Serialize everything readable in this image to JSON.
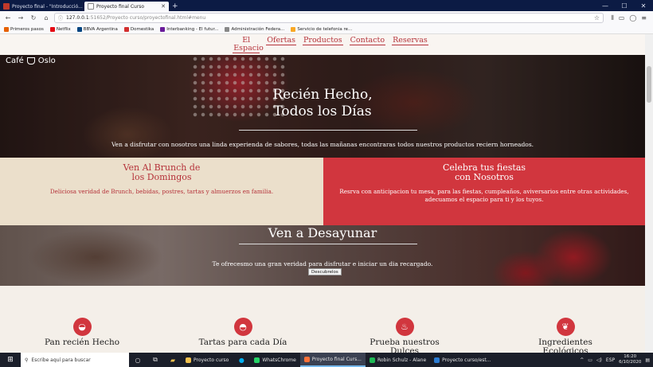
{
  "browser": {
    "tabs": [
      {
        "label": "Proyecto final - \"Introducció...",
        "active": false
      },
      {
        "label": "Proyecto final Curso",
        "active": true
      }
    ],
    "new_tab": "+",
    "window_controls": {
      "minimize": "—",
      "maximize": "☐",
      "close": "✕"
    },
    "url_prefix": "127.0.0.1",
    "url_rest": ":51652/Proyecto curso/proyectofinal.html#menu",
    "bookmarks": [
      {
        "label": "Primeros pasos",
        "color": "#e66000"
      },
      {
        "label": "Netflix",
        "color": "#e50914"
      },
      {
        "label": "BBVA Argentina",
        "color": "#004481"
      },
      {
        "label": "Domestika",
        "color": "#d32f2f"
      },
      {
        "label": "Interbanking - El futur...",
        "color": "#6a1b9a"
      },
      {
        "label": "Administración Federa...",
        "color": "#888888"
      },
      {
        "label": "Servicio de telefonia re...",
        "color": "#f9a825"
      }
    ]
  },
  "site": {
    "nav": [
      "El Espacio",
      "Ofertas",
      "Productos",
      "Contacto",
      "Reservas"
    ],
    "logo_left": "Café",
    "logo_right": "Oslo",
    "hero_title_1": "Recién Hecho,",
    "hero_title_2": "Todos los Días",
    "hero_text": "Ven a disfrutar con nosotros una linda experienda de sabores, todas las mañanas encontraras todos nuestros productos reciern horneados.",
    "brunch_title_1": "Ven Al Brunch de",
    "brunch_title_2": "los Domingos",
    "brunch_text": "Deliciosa veridad de Brunch, bebidas, postres, tartas y almuerzos en familia.",
    "party_title_1": "Celebra tus fiestas",
    "party_title_2": "con Nosotros",
    "party_text": "Resrva con anticipacion tu mesa, para las fiestas, cumpleaños, aviversarios entre otras actividades, adecuamos el espacio para ti y los tuyos.",
    "breakfast_title": "Ven a Desayunar",
    "breakfast_text": "Te ofrecesmo una gran veridad para disfrutar e iniciar un dia recargado.",
    "breakfast_button": "Descubrelos",
    "features": [
      {
        "label_1": "Pan recién Hecho",
        "label_2": "",
        "icon": "bread-icon"
      },
      {
        "label_1": "Tartas para cada Día",
        "label_2": "",
        "icon": "pie-icon"
      },
      {
        "label_1": "Prueba nuestros",
        "label_2": "Dulces",
        "icon": "cupcake-icon"
      },
      {
        "label_1": "Ingredientes",
        "label_2": "Ecológicos",
        "icon": "leaf-icon"
      }
    ],
    "accent_color": "#d1363e"
  },
  "taskbar": {
    "search_placeholder": "Escribe aquí para buscar",
    "apps": [
      {
        "label": "Proyecto curso",
        "color": "#f2c14e",
        "active": false
      },
      {
        "label": "WhatsChrome",
        "color": "#25d366",
        "active": false
      },
      {
        "label": "Proyecto final Curs...",
        "color": "#ff7139",
        "active": true
      },
      {
        "label": "Robin Schulz - Alane",
        "color": "#1db954",
        "active": false
      },
      {
        "label": "Proyecto curso/est...",
        "color": "#2b7cd3",
        "active": false
      }
    ],
    "lang": "ESP",
    "time": "16:20",
    "date": "6/10/2020"
  }
}
